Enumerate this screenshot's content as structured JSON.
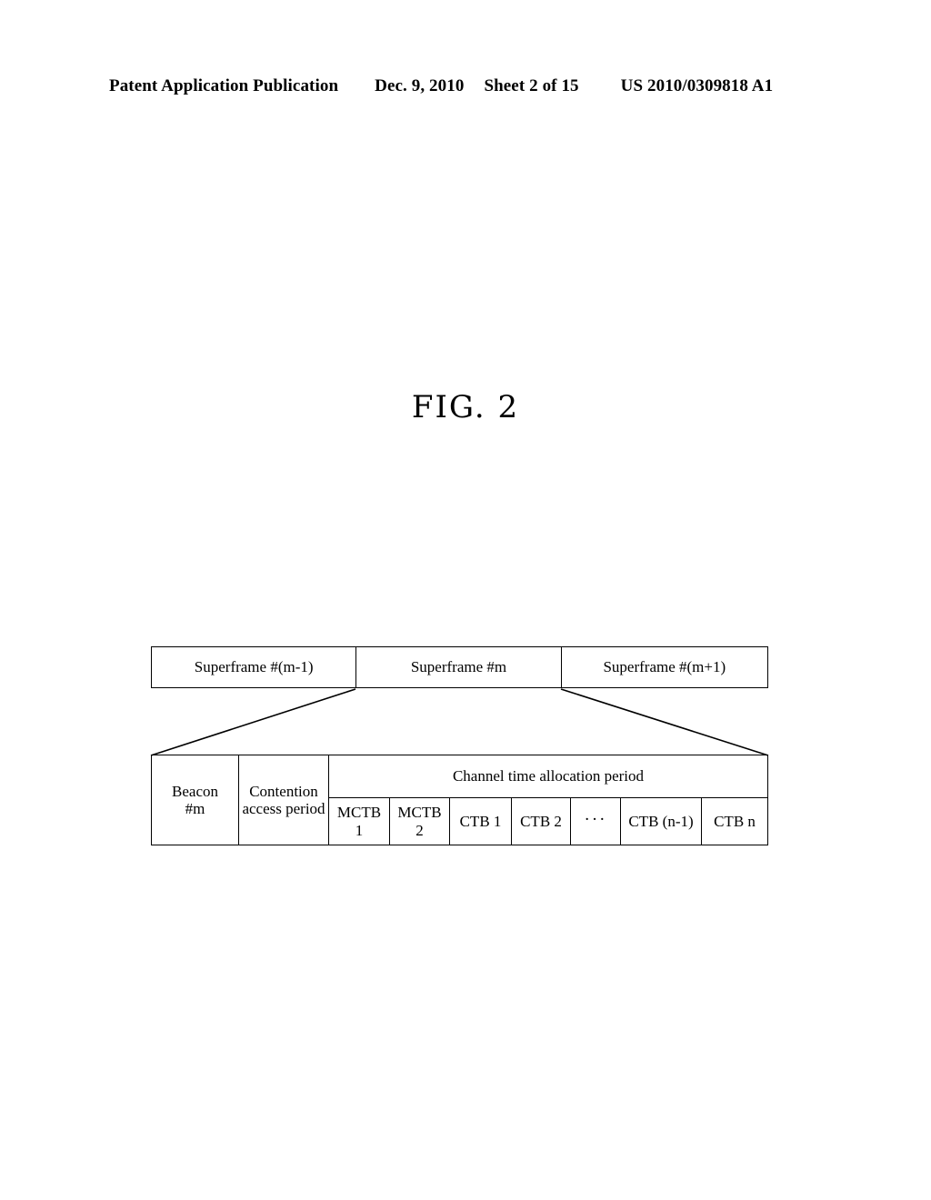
{
  "header": {
    "publication": "Patent Application Publication",
    "date": "Dec. 9, 2010",
    "sheet": "Sheet 2 of 15",
    "patent_number": "US 2010/0309818 A1"
  },
  "figure": {
    "title": "FIG. 2"
  },
  "diagram": {
    "superframes": [
      {
        "label": "Superframe #(m-1)"
      },
      {
        "label": "Superframe #m"
      },
      {
        "label": "Superframe #(m+1)"
      }
    ],
    "detail": {
      "beacon": {
        "line1": "Beacon",
        "line2": "#m"
      },
      "contention": {
        "line1": "Contention",
        "line2": "access period"
      },
      "cta_header": "Channel time allocation period",
      "blocks": [
        {
          "line1": "MCTB",
          "line2": "1"
        },
        {
          "line1": "MCTB",
          "line2": "2"
        },
        {
          "line1": "CTB 1",
          "line2": ""
        },
        {
          "line1": "CTB 2",
          "line2": ""
        },
        {
          "line1": "CTB (n-1)",
          "line2": ""
        },
        {
          "line1": "CTB n",
          "line2": ""
        }
      ],
      "ellipsis": "···"
    }
  },
  "colors": {
    "ink": "#000000",
    "paper": "#ffffff"
  }
}
